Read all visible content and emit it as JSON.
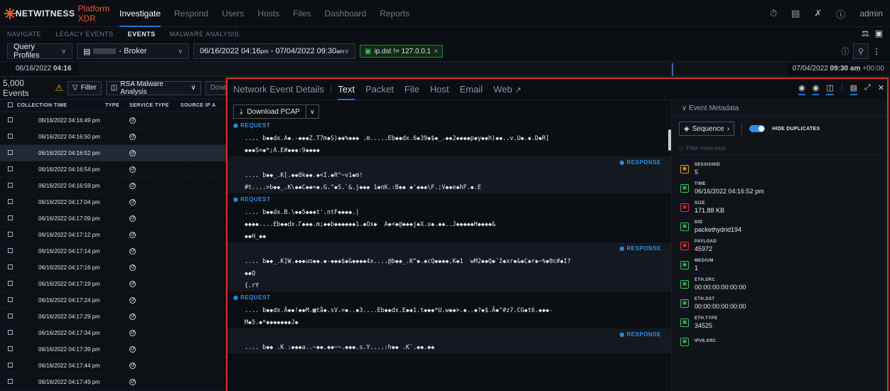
{
  "topbar": {
    "brand": "NETWITNESS",
    "brand_suffix": "Platform XDR",
    "nav": [
      "Investigate",
      "Respond",
      "Users",
      "Hosts",
      "Files",
      "Dashboard",
      "Reports"
    ],
    "user": "admin"
  },
  "subnav": {
    "items": [
      "NAVIGATE",
      "LEGACY EVENTS",
      "EVENTS",
      "MALWARE ANALYSIS"
    ]
  },
  "query": {
    "profiles_label": "Query Profiles",
    "broker_label": "- Broker",
    "date_start": "06/16/2022 04:16",
    "date_start_ampm": "pm",
    "date_end": "07/04/2022 09:30",
    "date_end_ampm": "am",
    "date_sep": " - ",
    "filter_pill": "ip.dst != 127.0.0.1"
  },
  "timeline": {
    "start_date": "06/16/2022 ",
    "start_time": "04:16 pm",
    "end_date": "07/04/2022 ",
    "end_time": "09:30 am",
    "end_tz": " +00:00"
  },
  "events": {
    "count": "5,000 Events",
    "filter_label": "Filter",
    "analysis_label": "RSA Malware Analysis",
    "download_label": "Download",
    "columns": [
      "COLLECTION TIME",
      "TYPE",
      "SERVICE TYPE",
      "SOURCE IP A"
    ],
    "rows": [
      "06/16/2022 04:16:49 pm",
      "06/16/2022 04:16:50 pm",
      "06/16/2022 04:16:52 pm",
      "06/16/2022 04:16:54 pm",
      "06/16/2022 04:16:59 pm",
      "06/16/2022 04:17:04 pm",
      "06/16/2022 04:17:09 pm",
      "06/16/2022 04:17:12 pm",
      "06/16/2022 04:17:14 pm",
      "06/16/2022 04:17:16 pm",
      "06/16/2022 04:17:19 pm",
      "06/16/2022 04:17:24 pm",
      "06/16/2022 04:17:29 pm",
      "06/16/2022 04:17:34 pm",
      "06/16/2022 04:17:39 pm",
      "06/16/2022 04:17:44 pm",
      "06/16/2022 04:17:49 pm"
    ],
    "selected_index": 2
  },
  "details": {
    "title": "Network Event Details",
    "tabs": [
      "Text",
      "Packet",
      "File",
      "Host",
      "Email",
      "Web"
    ],
    "download_pcap": "Download PCAP",
    "request_label": "REQUEST",
    "response_label": "RESPONSE",
    "blocks": [
      {
        "type": "request",
        "lines": [
          ".... b◆◆dx.A◆.-◆◆◆Z.T7m◆S)◆◆%◆◆◆ .m.....Eb◆◆dx.6◆39◆$◆_.◆◆2◆◆◆◆p◆y◆◆h)◆◆..v.U◆.◆.D◆R]",
          "◆◆◆S=◆*;A.E#◆◆◆:9◆◆◆◆"
        ]
      },
      {
        "type": "response",
        "lines": [
          ".... b◆◆_.K[.◆◆8k◆◆.◆<I.◆R^~v1◆m!",
          "#t....>b◆◆_.K\\◆◆C◆◆=◆.G.\"◆S.`&.j◆◆◆ 1◆nK.:B◆◆ ◆'◆◆◆\\F.;V◆◆e◆hF.◆.E"
        ]
      },
      {
        "type": "request",
        "lines": [
          ".... b◆◆dx.B.\\◆◆5◆◆◆t'.ntF◆◆◆◆.|",
          "◆◆◆◆....Eb◆◆dx.Γ◆◆◆.m;◆◆b◆◆◆◆◆◆1.◆Ox◆  A◆<◆@◆◆◆j◆X.u◆.◆◆..J◆◆◆◆◆H◆◆◆◆&",
          "◆◆H_◆◆"
        ]
      },
      {
        "type": "response",
        "lines": [
          ".... b◆◆_.K]W.◆◆◆uo◆◆.◆-◆◆◆$◆&◆◆◆◆4x....@b◆◆_.K^◆.◆cQ◆◆◆◆,K◆1  wM2◆◆Q◆`ž◆xr◆&◆C◆r◆~%◆Θc#◆I?",
          "◆◆Q",
          "{.rY"
        ]
      },
      {
        "type": "request",
        "lines": [
          ".... b◆◆dx.Ä◆◆!◆◆M.▦tå◆.sV.=◆..◆3....Eb◆◆dx.E◆◆1.t◆◆◆*U.w◆◆>.◆..◆?◆$.Ã◆\"#z7.CG◆t6.◆◆◆-",
          "M◆5.◆*◆◆◆◆◆◆◆J◆"
        ]
      },
      {
        "type": "response",
        "lines": [
          ".... b◆◆ .K :◆◆◆a..~◆◆.◆◆~~.◆◆◆.s.Y....:h◆◆ .K`.◆◆.◆◆"
        ]
      }
    ]
  },
  "metadata": {
    "header": "Event Metadata",
    "sequence_label": "Sequence",
    "hide_duplicates_label": "HIDE DUPLICATES",
    "filter_placeholder": "Filter meta keys",
    "items": [
      {
        "key": "SESSIONID",
        "value": "5",
        "icon": "session-icon",
        "color": "#e0a020"
      },
      {
        "key": "TIME",
        "value": "06/16/2022 04:16:52 pm",
        "icon": "clock-icon",
        "color": "#3ec45a"
      },
      {
        "key": "SIZE",
        "value": "171.88 KB",
        "icon": "size-icon",
        "color": "#e0312c"
      },
      {
        "key": "DID",
        "value": "packethydrid194",
        "icon": "database-icon",
        "color": "#3ec45a"
      },
      {
        "key": "PAYLOAD",
        "value": "45972",
        "icon": "cube-icon",
        "color": "#e0312c"
      },
      {
        "key": "MEDIUM",
        "value": "1",
        "icon": "medium-icon",
        "color": "#3ec45a"
      },
      {
        "key": "ETH.SRC",
        "value": "00:00:00:00:00:00",
        "icon": "network-icon",
        "color": "#3ec45a"
      },
      {
        "key": "ETH.DST",
        "value": "00:00:00:00:00:00",
        "icon": "network-icon",
        "color": "#3ec45a"
      },
      {
        "key": "ETH.TYPE",
        "value": "34525",
        "icon": "network-icon",
        "color": "#3ec45a"
      },
      {
        "key": "IPV6.SRC",
        "value": "",
        "icon": "network-icon",
        "color": "#3ec45a"
      }
    ]
  }
}
